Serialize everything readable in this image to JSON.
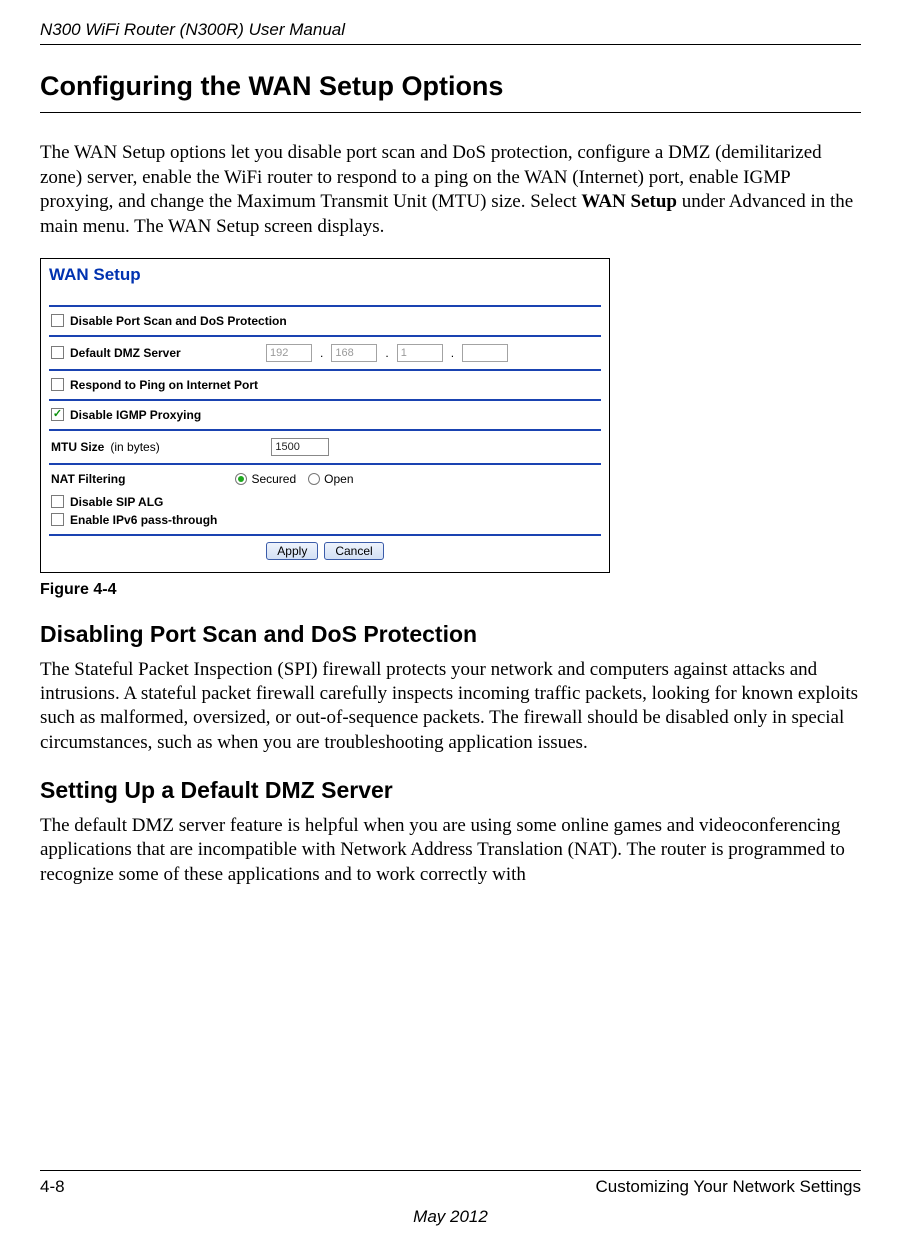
{
  "header": {
    "title": "N300 WiFi Router (N300R) User Manual"
  },
  "main": {
    "heading": "Configuring the WAN Setup Options",
    "intro_plain_1": "The WAN Setup options let you disable port scan and DoS protection, configure a DMZ (demilitarized zone) server, enable the WiFi router to respond to a ping on the WAN (Internet) port, enable IGMP proxying, and change the Maximum Transmit Unit (MTU) size. Select ",
    "intro_bold": "WAN Setup",
    "intro_plain_2": " under Advanced in the main menu. The WAN Setup screen displays."
  },
  "screenshot": {
    "title": "WAN Setup",
    "rows": {
      "disable_port_scan": {
        "label": "Disable Port Scan and DoS Protection",
        "checked": false
      },
      "dmz": {
        "label": "Default DMZ Server",
        "checked": false,
        "ip": [
          "192",
          "168",
          "1",
          ""
        ]
      },
      "respond_ping": {
        "label": "Respond to Ping on Internet Port",
        "checked": false
      },
      "disable_igmp": {
        "label": "Disable IGMP Proxying",
        "checked": true
      },
      "mtu": {
        "label_bold": "MTU Size",
        "label_thin": "(in bytes)",
        "value": "1500"
      },
      "nat": {
        "label": "NAT Filtering",
        "opt_secured": "Secured",
        "opt_open": "Open",
        "selected": "secured"
      },
      "disable_sip": {
        "label": "Disable SIP ALG",
        "checked": false
      },
      "enable_ipv6": {
        "label": "Enable IPv6 pass-through",
        "checked": false
      }
    },
    "buttons": {
      "apply": "Apply",
      "cancel": "Cancel"
    }
  },
  "figure_caption": "Figure 4-4",
  "sections": {
    "spi": {
      "heading": "Disabling Port Scan and DoS Protection",
      "body": "The Stateful Packet Inspection (SPI) firewall protects your network and computers against attacks and intrusions. A stateful packet firewall carefully inspects incoming traffic packets, looking for known exploits such as malformed, oversized, or out-of-sequence packets. The firewall should be disabled only in special circumstances, such as when you are troubleshooting application issues."
    },
    "dmz": {
      "heading": "Setting Up a Default DMZ Server",
      "body": "The default DMZ server feature is helpful when you are using some online games and videoconferencing applications that are incompatible with Network Address Translation (NAT). The router is programmed to recognize some of these applications and to work correctly with"
    }
  },
  "footer": {
    "page": "4-8",
    "chapter": "Customizing Your Network Settings",
    "date": "May 2012"
  }
}
